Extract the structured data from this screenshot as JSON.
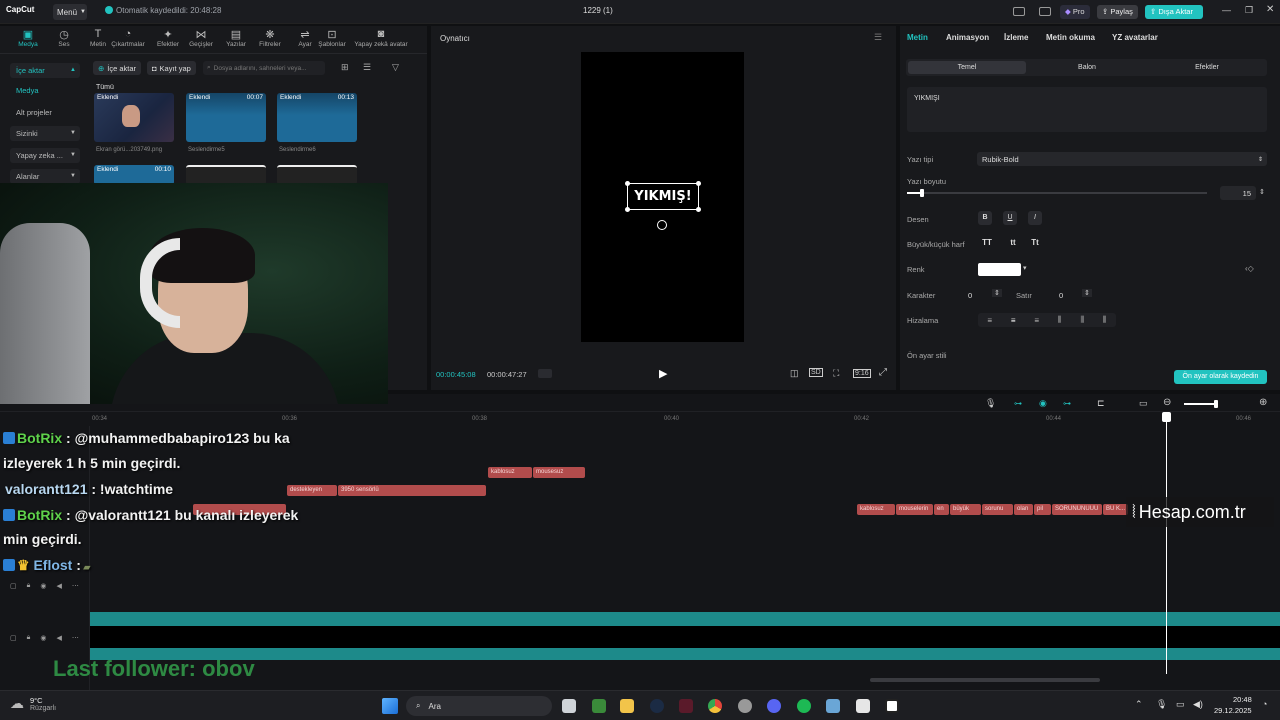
{
  "titlebar": {
    "logo": "CapCut",
    "menu": "Menü",
    "autosave": "Otomatik kaydedildi: 20:48:28",
    "project_title": "1229 (1)",
    "pro": "Pro",
    "share": "Paylaş",
    "export": "Dışa Aktar"
  },
  "toolbar": {
    "tabs": [
      {
        "label": "Medya",
        "icon": "media-icon"
      },
      {
        "label": "Ses",
        "icon": "audio-icon"
      },
      {
        "label": "Metin",
        "icon": "text-icon"
      },
      {
        "label": "Çıkartmalar",
        "icon": "sticker-icon"
      },
      {
        "label": "Efektler",
        "icon": "effects-icon"
      },
      {
        "label": "Geçişler",
        "icon": "transitions-icon"
      },
      {
        "label": "Yazılar",
        "icon": "captions-icon"
      },
      {
        "label": "Filtreler",
        "icon": "filters-icon"
      },
      {
        "label": "Ayar",
        "icon": "adjust-icon"
      },
      {
        "label": "Şablonlar",
        "icon": "templates-icon"
      },
      {
        "label": "Yapay zekâ avatar",
        "icon": "ai-avatar-icon"
      }
    ]
  },
  "media": {
    "sidebar": [
      "İçe aktar",
      "Medya",
      "Alt projeler",
      "Sizinki",
      "Yapay zeka ...",
      "Alanlar"
    ],
    "import_button": "İçe aktar",
    "record_button": "Kayıt yap",
    "search_placeholder": "Dosya adlarını, sahneleri veya...",
    "all_label": "Tümü",
    "clips": [
      {
        "badge": "Eklendi",
        "duration": "",
        "name": "Ekran görü...203749.png"
      },
      {
        "badge": "Eklendi",
        "duration": "00:07",
        "name": "Seslendirme5"
      },
      {
        "badge": "Eklendi",
        "duration": "00:13",
        "name": "Seslendirme6"
      },
      {
        "badge": "Eklendi",
        "duration": "00:10",
        "name": ""
      }
    ]
  },
  "player": {
    "title": "Oynatıcı",
    "overlay_text": "YIKMIŞ!",
    "current_time": "00:00:45:08",
    "total_time": "00:00:47:27",
    "ratio": "9:16"
  },
  "properties": {
    "tabs": [
      "Metin",
      "Animasyon",
      "İzleme",
      "Metin okuma",
      "YZ avatarlar"
    ],
    "subtabs": [
      "Temel",
      "Balon",
      "Efektler"
    ],
    "text_value": "YIKMIŞI",
    "font_label": "Yazı tipi",
    "font_value": "Rubik-Bold",
    "size_label": "Yazı boyutu",
    "size_value": "15",
    "size_fraction": 0.05,
    "pattern_label": "Desen",
    "case_label": "Büyük/küçük harf",
    "case_options": [
      "TT",
      "tt",
      "Tt"
    ],
    "color_label": "Renk",
    "color_value": "#ffffff",
    "char_label": "Karakter",
    "char_value": "0",
    "line_label": "Satır",
    "line_value": "0",
    "align_label": "Hizalama",
    "preset_label": "Ön ayar stili",
    "save_preset": "Ön ayar olarak kaydedin"
  },
  "timeline": {
    "ruler": [
      "00:34",
      "00:36",
      "00:38",
      "00:40",
      "00:42",
      "00:44",
      "00:46"
    ],
    "chips_row1": [
      "kablosuz",
      "mousesuz"
    ],
    "chips_row2": [
      "destekleyen",
      "3950 sensörlü"
    ],
    "chips_row3": [
      "kablosuz",
      "mouselerin",
      "en",
      "büyük",
      "sorunu",
      "olan",
      "pil",
      "SORUNUNUUU",
      "BU K..."
    ]
  },
  "overlay": {
    "chat": [
      {
        "user": "BotRix",
        "msg": ": @muhammedbabapiro123 bu ka"
      },
      {
        "user": "",
        "msg": "izleyerek 1 h 5 min geçirdi."
      },
      {
        "user": "valorantt121",
        "msg": ": !watchtime"
      },
      {
        "user": "BotRix",
        "msg": ": @valorantt121 bu kanalı izleyerek"
      },
      {
        "user": "",
        "msg": "min geçirdi."
      },
      {
        "user": "Eflost",
        "msg": ":"
      }
    ],
    "follower": "Last follower: obov",
    "watermark": "Hesap.com.tr"
  },
  "taskbar": {
    "weather_temp": "9°C",
    "weather_desc": "Rüzgarlı",
    "search": "Ara",
    "time": "20:48",
    "date": "29.12.2025"
  }
}
